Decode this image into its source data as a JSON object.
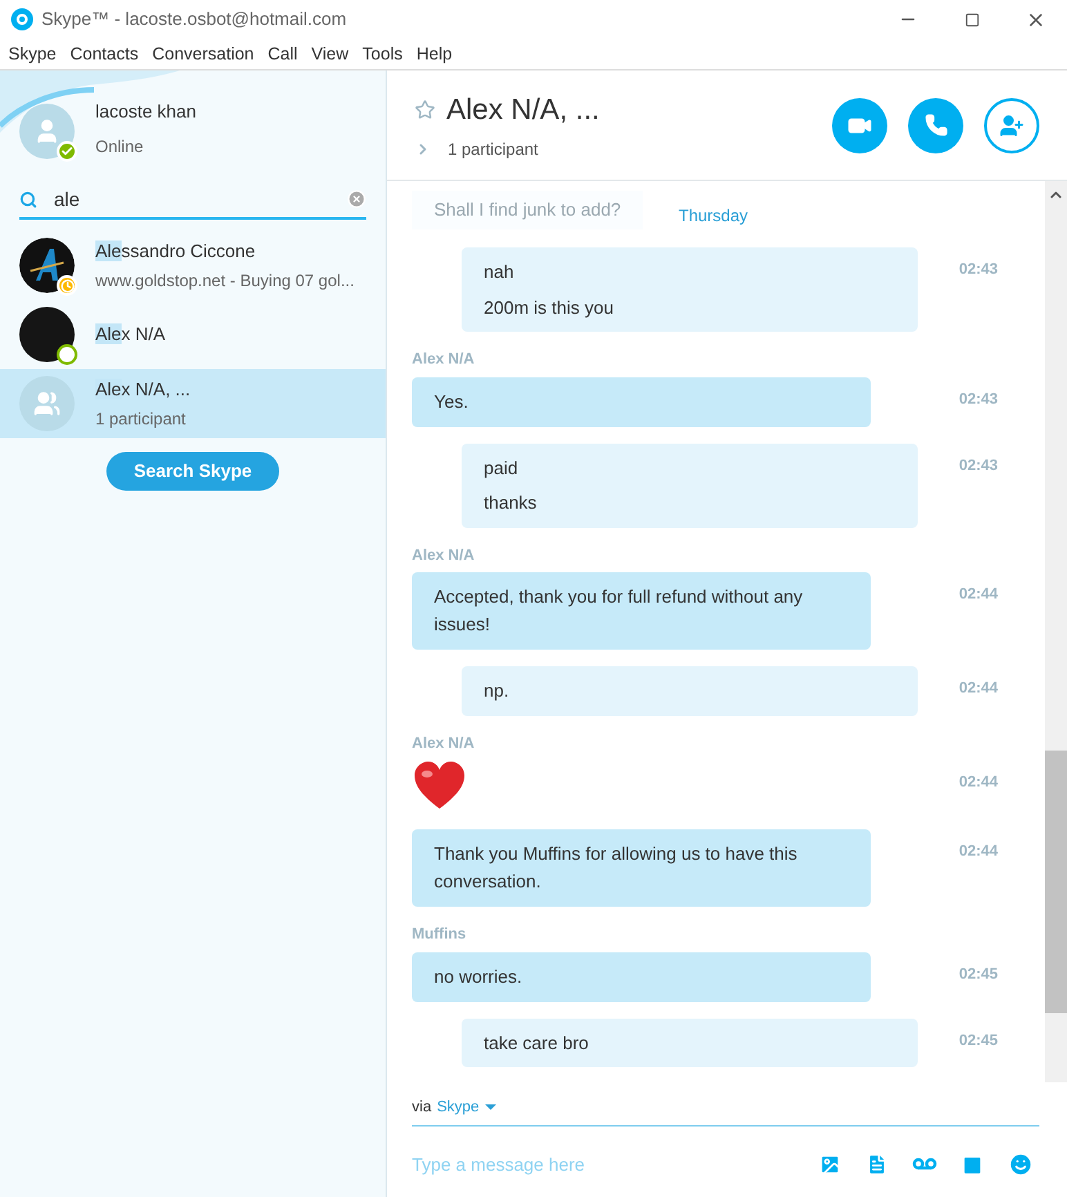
{
  "window": {
    "title": "Skype™ - lacoste.osbot@hotmail.com"
  },
  "menu": [
    "Skype",
    "Contacts",
    "Conversation",
    "Call",
    "View",
    "Tools",
    "Help"
  ],
  "profile": {
    "name": "lacoste khan",
    "status": "Online",
    "status_icon": {
      "kind": "online"
    }
  },
  "search": {
    "value": "ale"
  },
  "contacts": [
    {
      "match": "Ale",
      "rest": "ssandro Ciccone",
      "subtitle": "www.goldstop.net - Buying 07 gol...",
      "avatar": {
        "kind": "logo"
      },
      "status_icon": {
        "kind": "away"
      },
      "selected": false
    },
    {
      "match": "Ale",
      "rest": "x N/A",
      "avatar": {
        "kind": "dark"
      },
      "status_icon": {
        "kind": "offline"
      },
      "selected": false
    },
    {
      "match": "Ale",
      "rest": "x N/A, ...",
      "subtitle": "1 participant",
      "avatar": {
        "kind": "group"
      },
      "selected": true
    }
  ],
  "search_button": "Search Skype",
  "conversation": {
    "title": "Alex N/A, ...",
    "subtitle": "1 participant",
    "favorite": false
  },
  "faded_message": "Shall I find junk to add?",
  "day": "Thursday",
  "messages": [
    {
      "kind": "out",
      "lines": [
        "nah",
        "200m is this you"
      ],
      "time": "02:43"
    },
    {
      "kind": "in",
      "sender": "Alex N/A",
      "lines": [
        "Yes."
      ],
      "time": "02:43"
    },
    {
      "kind": "out",
      "lines": [
        "paid",
        "thanks"
      ],
      "time": "02:43"
    },
    {
      "kind": "in",
      "sender": "Alex N/A",
      "lines": [
        "Accepted, thank you for full refund without any issues!"
      ],
      "time": "02:44"
    },
    {
      "kind": "out",
      "lines": [
        "np."
      ],
      "time": "02:44"
    },
    {
      "kind": "heart",
      "sender": "Alex N/A",
      "time": "02:44"
    },
    {
      "kind": "in",
      "lines": [
        "Thank you Muffins for allowing us to have this conversation."
      ],
      "time": "02:44"
    },
    {
      "kind": "in",
      "sender": "Muffins",
      "lines": [
        "no worries."
      ],
      "time": "02:45"
    },
    {
      "kind": "out",
      "lines": [
        "take care bro"
      ],
      "time": "02:45"
    }
  ],
  "via": {
    "label": "via",
    "service": "Skype"
  },
  "composer": {
    "placeholder": "Type a message here"
  }
}
